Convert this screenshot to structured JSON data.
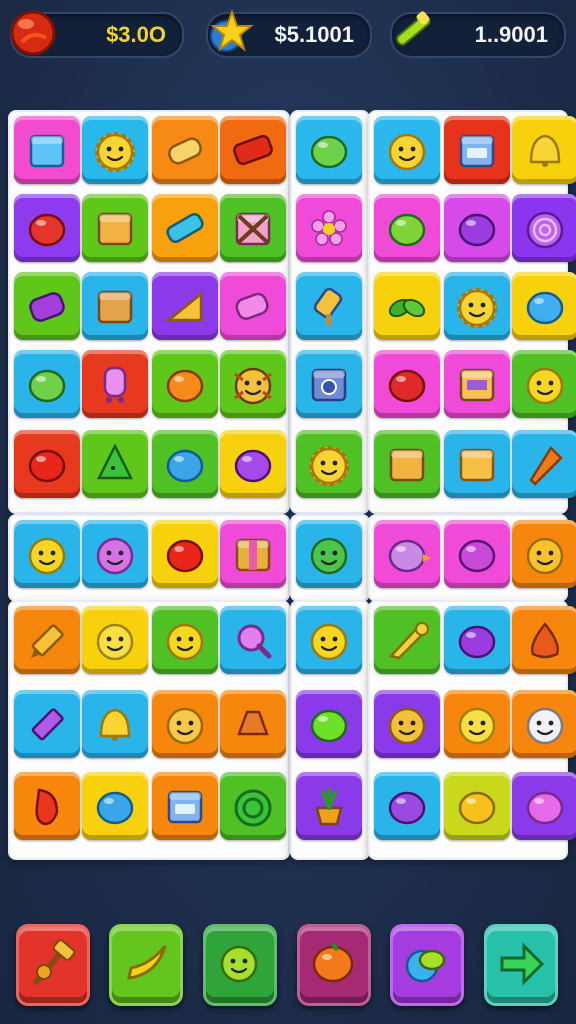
{
  "hud": {
    "coins": {
      "icon": "red-ball-icon",
      "value": "$3.0O"
    },
    "stars": {
      "icon": "star-icon",
      "value": "$5.1001"
    },
    "moves": {
      "icon": "wand-icon",
      "value": "1..9001"
    }
  },
  "colors": {
    "board": "#fdfdfd",
    "background": "#1f3050",
    "coin_text": "#f4d22c"
  },
  "grid": [
    [
      [
        "cube-icon",
        "#f24bd0"
      ],
      [
        "sun-face-icon",
        "#27b8ec"
      ],
      [
        "scroll-icon",
        "#f78a14"
      ],
      [
        "candy-roll-icon",
        "#f26a10"
      ],
      [
        "lime-icon",
        "#2bb8ee"
      ],
      [
        "smiley-fruit-icon",
        "#2bb8ee"
      ],
      [
        "robot-box-icon",
        "#e7331b"
      ],
      [
        "bell-icon",
        "#f7d20c"
      ]
    ],
    [
      [
        "strawberry-icon",
        "#8e3bf0"
      ],
      [
        "treasure-chest-icon",
        "#5fc71a"
      ],
      [
        "candy-tube-icon",
        "#f7a10c"
      ],
      [
        "crossed-box-icon",
        "#4fc125"
      ],
      [
        "flower-icon",
        "#f04ad9"
      ],
      [
        "lime-leaf-icon",
        "#f04ad9"
      ],
      [
        "plum-icon",
        "#d54ae8"
      ],
      [
        "spiral-candy-icon",
        "#8c35ee"
      ]
    ],
    [
      [
        "purple-pouch-icon",
        "#5fc71a"
      ],
      [
        "crate-icon",
        "#29b4ea"
      ],
      [
        "cheese-icon",
        "#8a3ae8"
      ],
      [
        "pink-tube-icon",
        "#f04ad9"
      ],
      [
        "ice-pop-icon",
        "#29b4ea"
      ],
      [
        "leaves-icon",
        "#f7d20c"
      ],
      [
        "sun-face-icon",
        "#29b4ea"
      ],
      [
        "blue-balloon-icon",
        "#f7d20c"
      ]
    ],
    [
      [
        "green-melon-icon",
        "#29b4ea"
      ],
      [
        "pink-robot-icon",
        "#e6391d"
      ],
      [
        "mango-icon",
        "#5fc71a"
      ],
      [
        "bug-icon",
        "#5fc71a"
      ],
      [
        "camera-icon",
        "#29b4ea"
      ],
      [
        "red-ribbon-icon",
        "#f04ad9"
      ],
      [
        "chest-icon",
        "#f04ad9"
      ],
      [
        "lemon-face-icon",
        "#4fc125"
      ]
    ],
    [
      [
        "cherry-icon",
        "#e6391d"
      ],
      [
        "elf-hat-icon",
        "#5fc71a"
      ],
      [
        "blue-orb-icon",
        "#4fc125"
      ],
      [
        "grape-icon",
        "#f7d20c"
      ],
      [
        "sun-face-icon",
        "#4fc125"
      ],
      [
        "bag-icon",
        "#4fc125"
      ],
      [
        "toast-icon",
        "#29b4ea"
      ],
      [
        "carrot-icon",
        "#29b4ea"
      ]
    ],
    [
      [
        "lemon-face-icon",
        "#29b4ea"
      ],
      [
        "pink-skull-icon",
        "#29b4ea"
      ],
      [
        "apple-icon",
        "#f7d20c"
      ],
      [
        "candy-box-icon",
        "#f04ad9"
      ],
      [
        "frog-icon",
        "#29b4ea"
      ],
      [
        "bird-icon",
        "#f04ad9"
      ],
      [
        "berry-icon",
        "#f04ad9"
      ],
      [
        "egg-face-icon",
        "#f7860c"
      ]
    ],
    [
      [
        "crayon-icon",
        "#f7860c"
      ],
      [
        "banana-face-icon",
        "#f7d20c"
      ],
      [
        "lemon-face-icon",
        "#4fc125"
      ],
      [
        "magnifier-icon",
        "#29b4ea"
      ],
      [
        "lemon-face-icon",
        "#29b4ea"
      ],
      [
        "horn-icon",
        "#4fc125"
      ],
      [
        "plum-icon",
        "#29b4ea"
      ],
      [
        "onion-icon",
        "#f7860c"
      ]
    ],
    [
      [
        "purple-crayon-icon",
        "#29b4ea"
      ],
      [
        "bell-icon",
        "#29b4ea"
      ],
      [
        "pear-face-icon",
        "#f7860c"
      ],
      [
        "lamp-icon",
        "#f7860c"
      ],
      [
        "green-berry-icon",
        "#8a3ae8"
      ],
      [
        "owl-face-icon",
        "#8a3ae8"
      ],
      [
        "banana-face-icon",
        "#f7860c"
      ],
      [
        "ghost-icon",
        "#f7860c"
      ]
    ],
    [
      [
        "red-pepper-icon",
        "#f7860c"
      ],
      [
        "blue-disc-icon",
        "#f7d20c"
      ],
      [
        "robot-box-icon",
        "#f7860c"
      ],
      [
        "green-ring-icon",
        "#4fc125"
      ],
      [
        "plant-pot-icon",
        "#8a3ae8"
      ],
      [
        "purple-ball-icon",
        "#29b4ea"
      ],
      [
        "yellow-disc-icon",
        "#c9d81a"
      ],
      [
        "pink-balloon-icon",
        "#8a3ae8"
      ]
    ]
  ],
  "buttons": [
    {
      "icon": "hammer-tool-icon",
      "color": "#e3342b"
    },
    {
      "icon": "banana-icon",
      "color": "#63c51d"
    },
    {
      "icon": "green-lemon-face-icon",
      "color": "#2fa43a"
    },
    {
      "icon": "orange-fruit-icon",
      "color": "#a52a73"
    },
    {
      "icon": "mixed-fruit-icon",
      "color": "#a53ce0"
    },
    {
      "icon": "green-arrow-icon",
      "color": "#27c0a8"
    }
  ]
}
